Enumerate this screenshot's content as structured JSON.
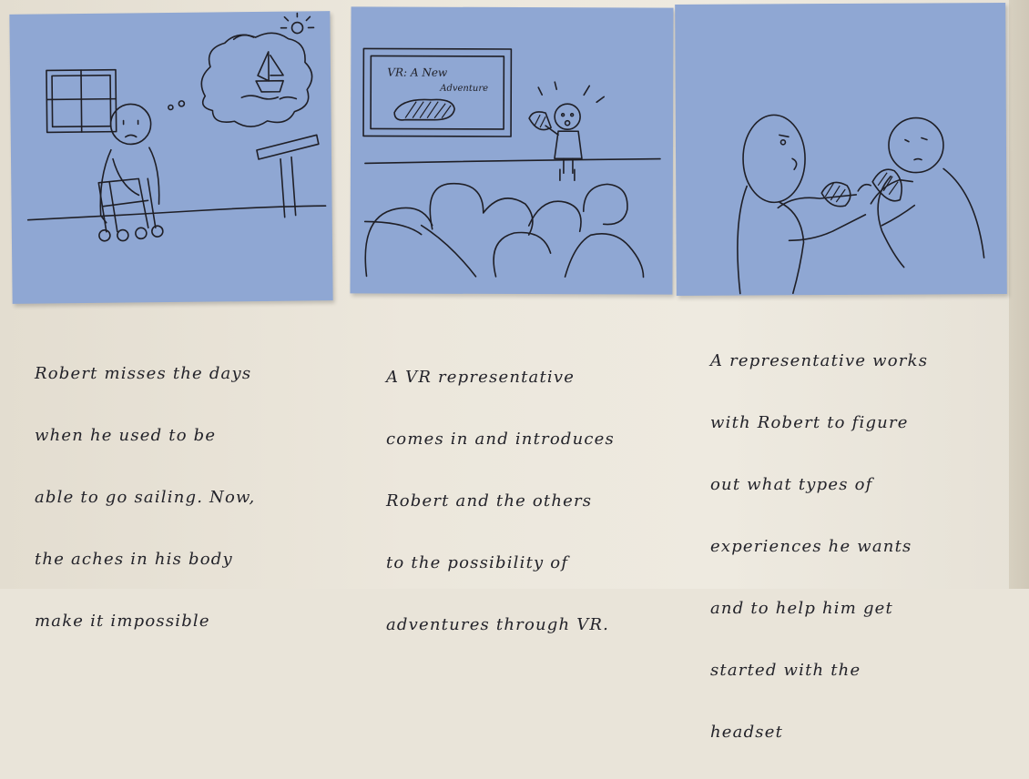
{
  "panels": [
    {
      "id": "sailing-memory",
      "caption_lines": [
        "Robert misses the days",
        "when he used to be",
        "able to go sailing. Now,",
        "the aches in his body",
        "make it impossible"
      ]
    },
    {
      "id": "vr-presentation",
      "screen_title": "VR: A New",
      "screen_subtitle": "Adventure",
      "caption_lines": [
        "A VR representative",
        "comes in and introduces",
        "Robert and the others",
        "to the possibility of",
        "adventures through VR."
      ]
    },
    {
      "id": "headset-help",
      "caption_lines": [
        "A representative works",
        "with Robert to figure",
        "out what types of",
        "experiences he wants",
        "and to help him get",
        "started with the",
        "headset"
      ]
    }
  ],
  "colors": {
    "note": "#8fa7d3",
    "paper": "#e9e4d9",
    "ink": "#1f1f26"
  }
}
